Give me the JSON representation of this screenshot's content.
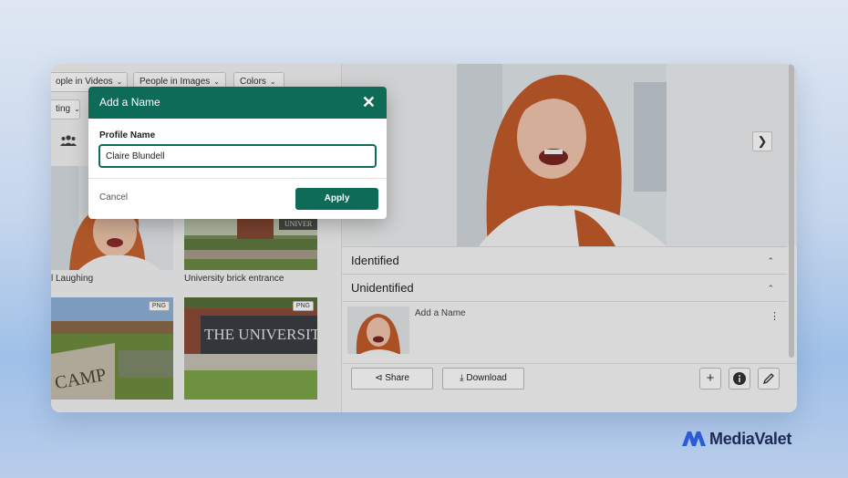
{
  "filters": {
    "people_in_videos": "ople in Videos",
    "people_in_images": "People in Images",
    "colors": "Colors",
    "sorting": "ting"
  },
  "grid": {
    "items": [
      {
        "caption": "l Laughing"
      },
      {
        "caption": "University brick entrance"
      },
      {
        "badge": "PNG"
      },
      {
        "badge": "PNG"
      }
    ]
  },
  "panel": {
    "identified_label": "Identified",
    "unidentified_label": "Unidentified",
    "face_label": "Add a Name",
    "share_label": "Share",
    "download_label": "Download"
  },
  "modal": {
    "title": "Add a Name",
    "field_label": "Profile Name",
    "field_value": "Claire Blundell",
    "cancel_label": "Cancel",
    "apply_label": "Apply"
  },
  "brand": {
    "name": "MediaValet",
    "color": "#1d2a55",
    "accent": "#2b5bd7"
  },
  "colors": {
    "primary_green": "#0d6b57"
  }
}
